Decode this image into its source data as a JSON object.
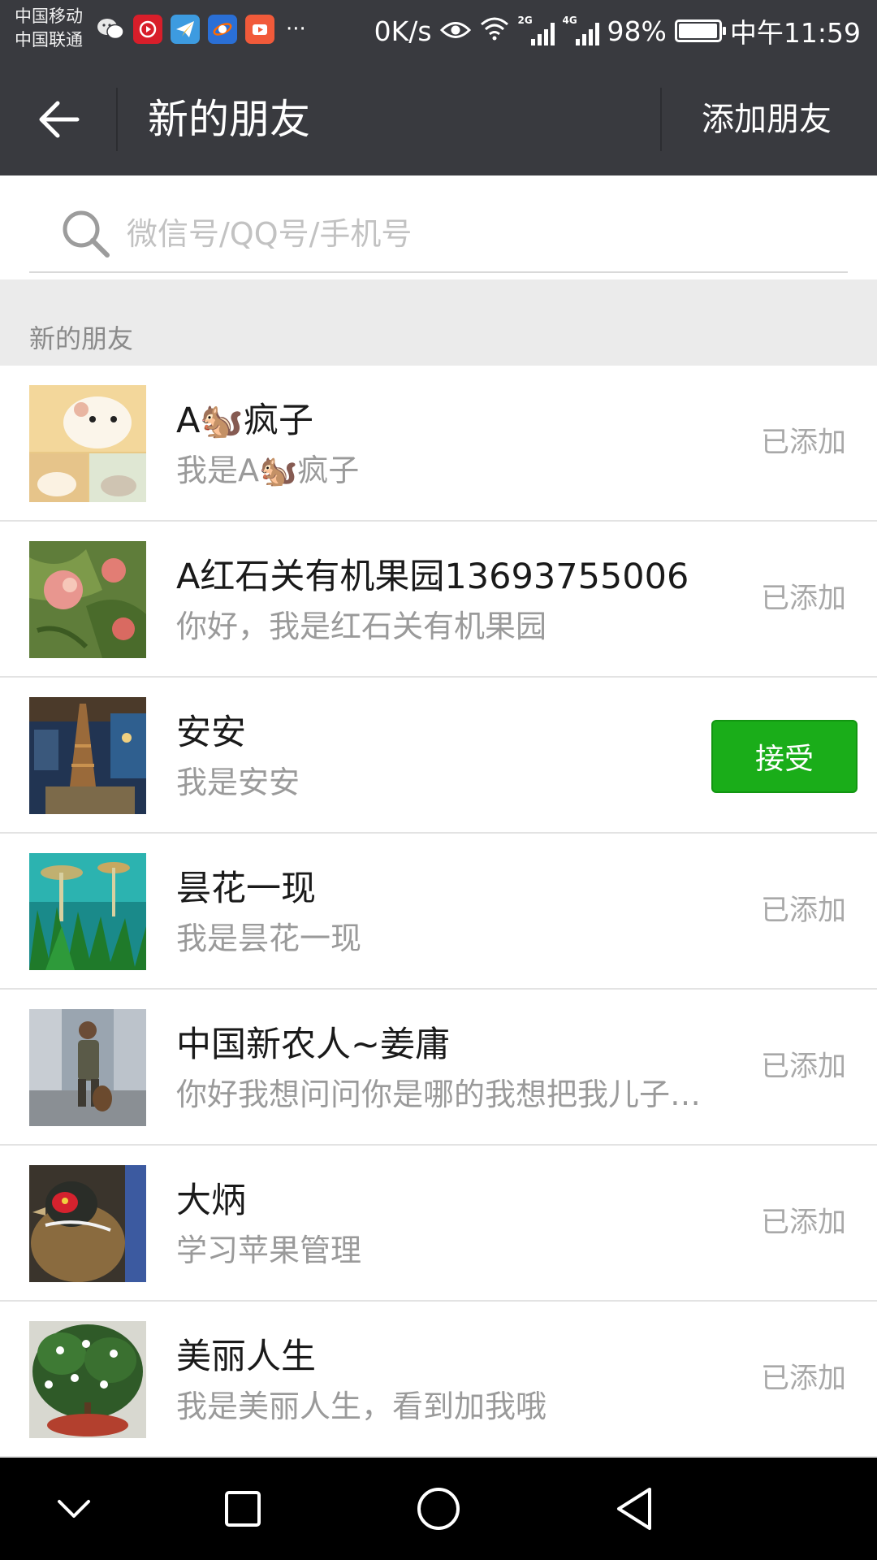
{
  "status_bar": {
    "carrier_1": "中国移动",
    "carrier_2": "中国联通",
    "net_speed": "0K/s",
    "net_2g": "2G",
    "net_4g": "4G",
    "battery": "98%",
    "battery_fraction": 0.98,
    "time": "中午11:59",
    "more": "···",
    "app_icons": [
      "wechat-icon",
      "netease-music-icon",
      "paper-plane-app-icon",
      "browser-app-icon",
      "video-app-icon"
    ]
  },
  "header": {
    "title": "新的朋友",
    "add_friend": "添加朋友"
  },
  "search": {
    "placeholder": "微信号/QQ号/手机号"
  },
  "section": {
    "title": "新的朋友"
  },
  "friends": [
    {
      "name": "A🐿️疯子",
      "message": "我是A🐿️疯子",
      "status": "已添加"
    },
    {
      "name": "A红石关有机果园13693755006",
      "message": "你好，我是红石关有机果园",
      "status": "已添加"
    },
    {
      "name": "安安",
      "message": "我是安安",
      "action": "接受"
    },
    {
      "name": "昙花一现",
      "message": "我是昙花一现",
      "status": "已添加"
    },
    {
      "name": "中国新农人~姜庸",
      "message": "你好我想问问你是哪的我想把我儿子…",
      "status": "已添加"
    },
    {
      "name": "大炳",
      "message": "学习苹果管理",
      "status": "已添加"
    },
    {
      "name": "美丽人生",
      "message": "我是美丽人生，看到加我哦",
      "status": "已添加"
    }
  ],
  "colors": {
    "header_bg": "#393a3f",
    "accept_green": "#1aad19",
    "section_bg": "#ebebeb"
  }
}
